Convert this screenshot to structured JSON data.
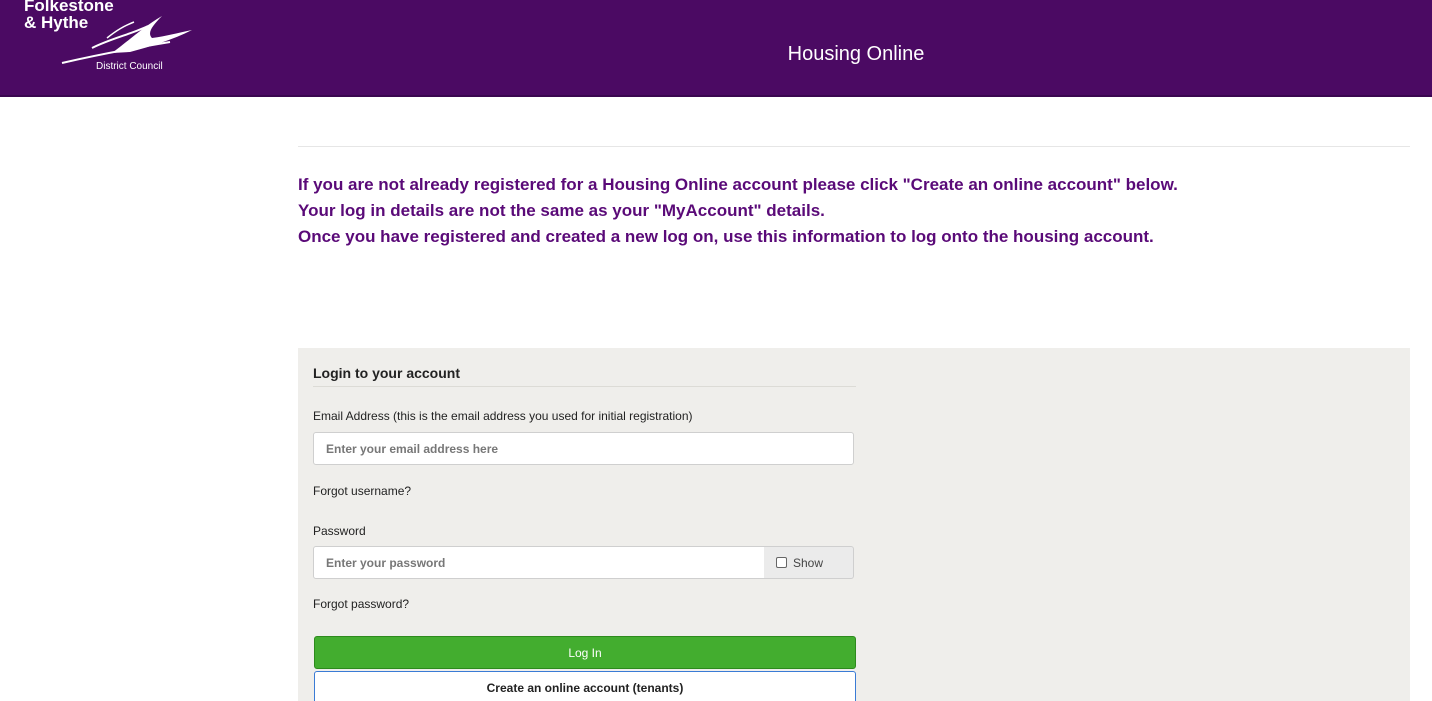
{
  "header": {
    "logo_line1": "Folkestone",
    "logo_line2": "& Hythe",
    "logo_line3": "District Council",
    "title": "Housing Online",
    "background": "#4b0a63"
  },
  "notice": {
    "line1": "If you are not already registered for a Housing Online account please click \"Create an online account\" below.",
    "line2": "Your log in details are not the same as your \"MyAccount\" details.",
    "line3": "Once you have registered and created a new log on, use this information to log onto the housing account.",
    "color": "#5a0a78"
  },
  "login": {
    "title": "Login to your account",
    "email_label": "Email Address (this is the email address you used for initial registration)",
    "email_placeholder": "Enter your email address here",
    "email_value": "",
    "forgot_username": "Forgot username?",
    "password_label": "Password",
    "password_placeholder": "Enter your password",
    "password_value": "",
    "show_label": "Show",
    "forgot_password": "Forgot password?",
    "login_button": "Log In",
    "create_button": "Create an online account (tenants)",
    "login_color": "#43ad2f"
  }
}
